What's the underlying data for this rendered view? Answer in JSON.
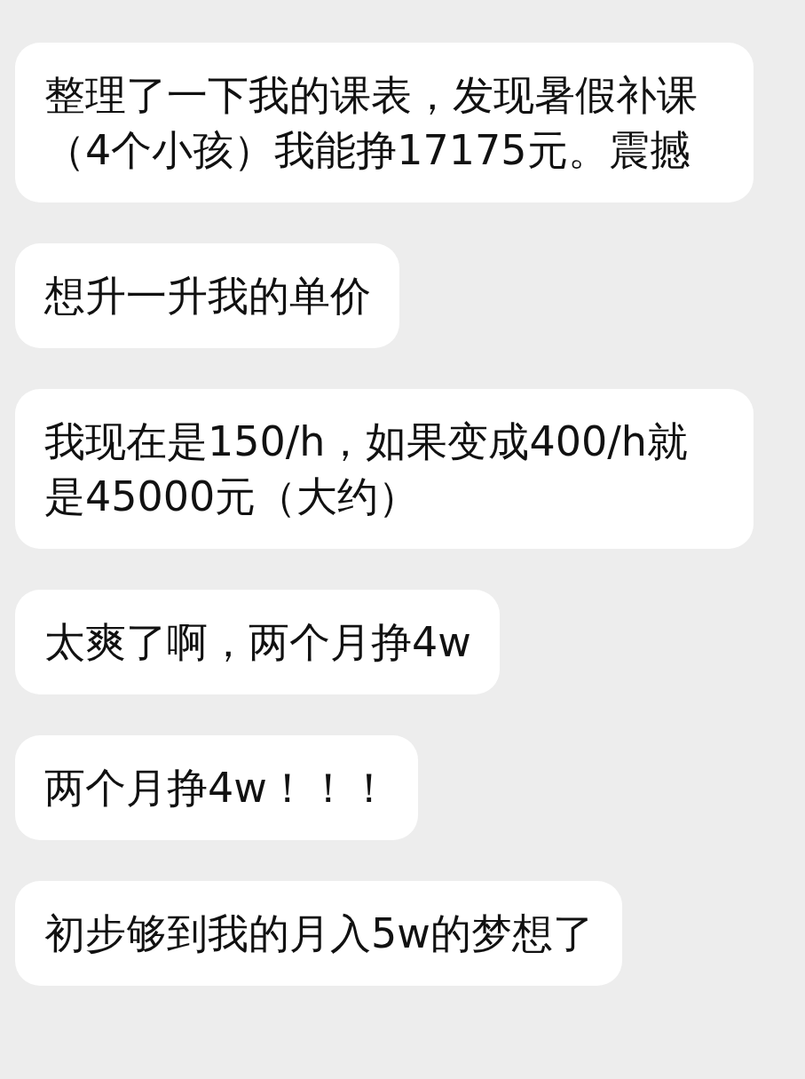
{
  "messages": [
    {
      "text": "整理了一下我的课表，发现暑假补课（4个小孩）我能挣17175元。震撼"
    },
    {
      "text": "想升一升我的单价"
    },
    {
      "text": "我现在是150/h，如果变成400/h就是45000元（大约）"
    },
    {
      "text": "太爽了啊，两个月挣4w"
    },
    {
      "text": "两个月挣4w！！！"
    },
    {
      "text": "初步够到我的月入5w的梦想了"
    }
  ]
}
